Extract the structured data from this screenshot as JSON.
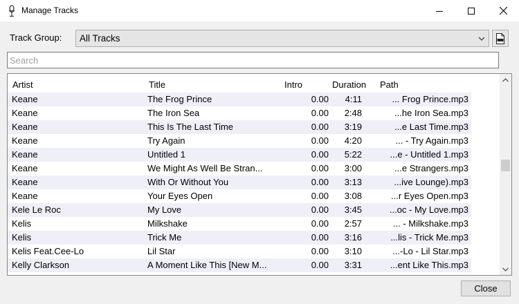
{
  "window": {
    "title": "Manage Tracks",
    "app_icon": "microphone-icon",
    "controls": [
      "minimize-icon",
      "maximize-icon",
      "close-icon"
    ]
  },
  "filter": {
    "track_group_label": "Track Group:",
    "track_group_value": "All Tracks",
    "csv_icon": "csv-file-icon",
    "search_placeholder": "Search",
    "search_value": ""
  },
  "table": {
    "columns": [
      "Artist",
      "Title",
      "Intro",
      "Duration",
      "Path"
    ],
    "rows": [
      {
        "artist": "Keane",
        "title": "The Frog Prince",
        "intro": "0.00",
        "duration": "4:11",
        "path": "... Frog Prince.mp3"
      },
      {
        "artist": "Keane",
        "title": "The Iron Sea",
        "intro": "0.00",
        "duration": "2:48",
        "path": "...he Iron Sea.mp3"
      },
      {
        "artist": "Keane",
        "title": "This Is The Last Time",
        "intro": "0.00",
        "duration": "3:19",
        "path": "...e Last Time.mp3"
      },
      {
        "artist": "Keane",
        "title": "Try Again",
        "intro": "0.00",
        "duration": "4:20",
        "path": "... - Try Again.mp3"
      },
      {
        "artist": "Keane",
        "title": "Untitled 1",
        "intro": "0.00",
        "duration": "5:22",
        "path": "...e - Untitled 1.mp3"
      },
      {
        "artist": "Keane",
        "title": "We Might As Well Be Stran...",
        "intro": "0.00",
        "duration": "3:00",
        "path": "...e Strangers.mp3"
      },
      {
        "artist": "Keane",
        "title": "With Or Without You",
        "intro": "0.00",
        "duration": "3:13",
        "path": "...ive Lounge).mp3"
      },
      {
        "artist": "Keane",
        "title": "Your Eyes Open",
        "intro": "0.00",
        "duration": "3:08",
        "path": "...r Eyes Open.mp3"
      },
      {
        "artist": "Kele Le Roc",
        "title": "My Love",
        "intro": "0.00",
        "duration": "3:45",
        "path": "...oc - My Love.mp3"
      },
      {
        "artist": "Kelis",
        "title": "Milkshake",
        "intro": "0.00",
        "duration": "2:57",
        "path": "... - Milkshake.mp3"
      },
      {
        "artist": "Kelis",
        "title": "Trick Me",
        "intro": "0.00",
        "duration": "3:16",
        "path": "...lis - Trick Me.mp3"
      },
      {
        "artist": "Kelis Feat.Cee-Lo",
        "title": "Lil Star",
        "intro": "0.00",
        "duration": "3:10",
        "path": "...-Lo - Lil Star.mp3"
      },
      {
        "artist": "Kelly Clarkson",
        "title": "A Moment Like This [New M...",
        "intro": "0.00",
        "duration": "3:31",
        "path": "...ent Like This.mp3"
      }
    ]
  },
  "footer": {
    "close_label": "Close"
  }
}
